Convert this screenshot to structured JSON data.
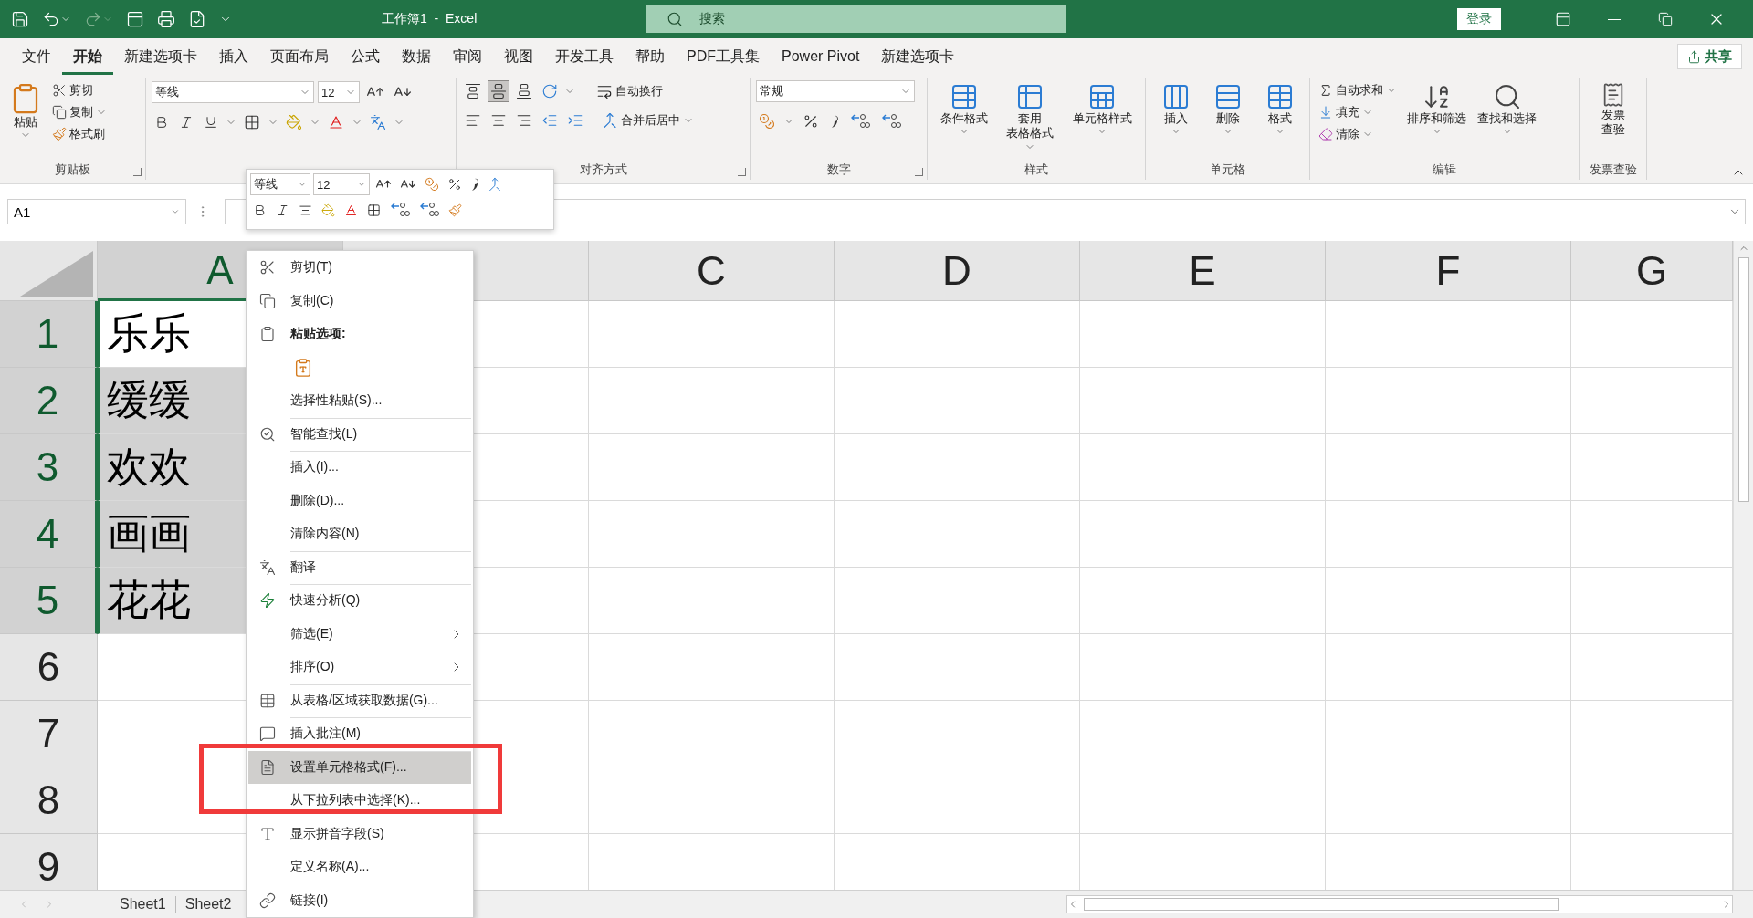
{
  "title_bar": {
    "title": "工作簿1  -  Excel",
    "search_placeholder": "搜索",
    "login_button": "登录"
  },
  "menu_tabs": [
    {
      "label": "文件",
      "selected": false
    },
    {
      "label": "开始",
      "selected": true
    },
    {
      "label": "新建选项卡",
      "selected": false
    },
    {
      "label": "插入",
      "selected": false
    },
    {
      "label": "页面布局",
      "selected": false
    },
    {
      "label": "公式",
      "selected": false
    },
    {
      "label": "数据",
      "selected": false
    },
    {
      "label": "审阅",
      "selected": false
    },
    {
      "label": "视图",
      "selected": false
    },
    {
      "label": "开发工具",
      "selected": false
    },
    {
      "label": "帮助",
      "selected": false
    },
    {
      "label": "PDF工具集",
      "selected": false
    },
    {
      "label": "Power Pivot",
      "selected": false
    },
    {
      "label": "新建选项卡",
      "selected": false
    }
  ],
  "share_button": "共享",
  "ribbon": {
    "clipboard": {
      "label": "剪贴板",
      "paste": "粘贴",
      "cut": "剪切",
      "copy": "复制",
      "format_painter": "格式刷"
    },
    "font": {
      "font_name": "等线",
      "font_size": "12"
    },
    "alignment": {
      "label": "对齐方式",
      "wrap_text": "自动换行",
      "merge_center": "合并后居中",
      "vertical_align": [
        {
          "selected": false
        },
        {
          "selected": true
        },
        {
          "selected": false
        }
      ]
    },
    "number": {
      "label": "数字",
      "format": "常规"
    },
    "styles": {
      "label": "样式",
      "buttons": [
        {
          "lines": [
            "条件格式"
          ]
        },
        {
          "lines": [
            "套用",
            "表格格式"
          ]
        },
        {
          "lines": [
            "单元格样式"
          ]
        }
      ]
    },
    "cells": {
      "label": "单元格",
      "buttons": [
        "插入",
        "删除",
        "格式"
      ]
    },
    "editing": {
      "label": "编辑",
      "autosum": "自动求和",
      "fill": "填充",
      "clear": "清除",
      "sort_filter": "排序和筛选",
      "find_select": "查找和选择"
    },
    "invoice": {
      "label": "发票查验",
      "button_lines": [
        "发票",
        "查验"
      ]
    }
  },
  "formula_bar": {
    "name_box": "A1"
  },
  "sheet": {
    "columns": [
      {
        "label": "A",
        "selected": true
      },
      {
        "selected": false
      },
      {
        "label": "C",
        "selected": false
      },
      {
        "label": "D",
        "selected": false
      },
      {
        "label": "E",
        "selected": false
      },
      {
        "label": "F",
        "selected": false
      },
      {
        "label": "G",
        "selected": false
      }
    ],
    "rows": [
      {
        "label": "1",
        "selected": true,
        "cell": {
          "value": "乐乐",
          "active": true
        }
      },
      {
        "label": "2",
        "selected": true,
        "cell": {
          "value": "缓缓",
          "active": false
        }
      },
      {
        "label": "3",
        "selected": true,
        "cell": {
          "value": "欢欢",
          "active": false
        }
      },
      {
        "label": "4",
        "selected": true,
        "cell": {
          "value": "画画",
          "active": false
        }
      },
      {
        "label": "5",
        "selected": true,
        "cell": {
          "value": "花花",
          "active": false
        }
      },
      {
        "label": "6",
        "selected": false
      },
      {
        "label": "7",
        "selected": false
      },
      {
        "label": "8",
        "selected": false
      },
      {
        "label": "9",
        "selected": false
      }
    ]
  },
  "mini_toolbar": {
    "font_name": "等线",
    "font_size": "12"
  },
  "context_menu": {
    "items": [
      {
        "kind": "item",
        "label": "剪切(T)",
        "separated": false,
        "highlighted": false,
        "submenu": false
      },
      {
        "kind": "item",
        "label": "复制(C)",
        "separated": false,
        "highlighted": false,
        "submenu": false
      },
      {
        "kind": "header",
        "label": "粘贴选项:",
        "separated": false,
        "highlighted": false,
        "submenu": false,
        "paste_buttons": [
          {
            "kind": "text_only"
          }
        ]
      },
      {
        "kind": "item",
        "label": "选择性粘贴(S)...",
        "separated": false,
        "highlighted": false,
        "submenu": false
      },
      {
        "kind": "item",
        "label": "智能查找(L)",
        "separated": true,
        "highlighted": false,
        "submenu": false
      },
      {
        "kind": "item",
        "label": "插入(I)...",
        "separated": true,
        "highlighted": false,
        "submenu": false
      },
      {
        "kind": "item",
        "label": "删除(D)...",
        "separated": false,
        "highlighted": false,
        "submenu": false
      },
      {
        "kind": "item",
        "label": "清除内容(N)",
        "separated": false,
        "highlighted": false,
        "submenu": false
      },
      {
        "kind": "item",
        "label": "翻译",
        "separated": true,
        "highlighted": false,
        "submenu": false
      },
      {
        "kind": "item",
        "label": "快速分析(Q)",
        "separated": true,
        "highlighted": false,
        "submenu": false
      },
      {
        "kind": "item",
        "label": "筛选(E)",
        "separated": false,
        "highlighted": false,
        "submenu": true
      },
      {
        "kind": "item",
        "label": "排序(O)",
        "separated": false,
        "highlighted": false,
        "submenu": true
      },
      {
        "kind": "item",
        "label": "从表格/区域获取数据(G)...",
        "separated": true,
        "highlighted": false,
        "submenu": false
      },
      {
        "kind": "item",
        "label": "插入批注(M)",
        "separated": true,
        "highlighted": false,
        "submenu": false
      },
      {
        "kind": "item",
        "label": "设置单元格格式(F)...",
        "separated": true,
        "highlighted": true,
        "submenu": false
      },
      {
        "kind": "item",
        "label": "从下拉列表中选择(K)...",
        "separated": false,
        "highlighted": false,
        "submenu": false
      },
      {
        "kind": "item",
        "label": "显示拼音字段(S)",
        "separated": false,
        "highlighted": false,
        "submenu": false
      },
      {
        "kind": "item",
        "label": "定义名称(A)...",
        "separated": false,
        "highlighted": false,
        "submenu": false
      },
      {
        "kind": "item",
        "label": "链接(I)",
        "separated": false,
        "highlighted": false,
        "submenu": false
      }
    ]
  },
  "sheet_tabs": [
    {
      "label": "Sheet1"
    },
    {
      "label": "Sheet2"
    }
  ],
  "highlight_box": {
    "shown": true
  }
}
